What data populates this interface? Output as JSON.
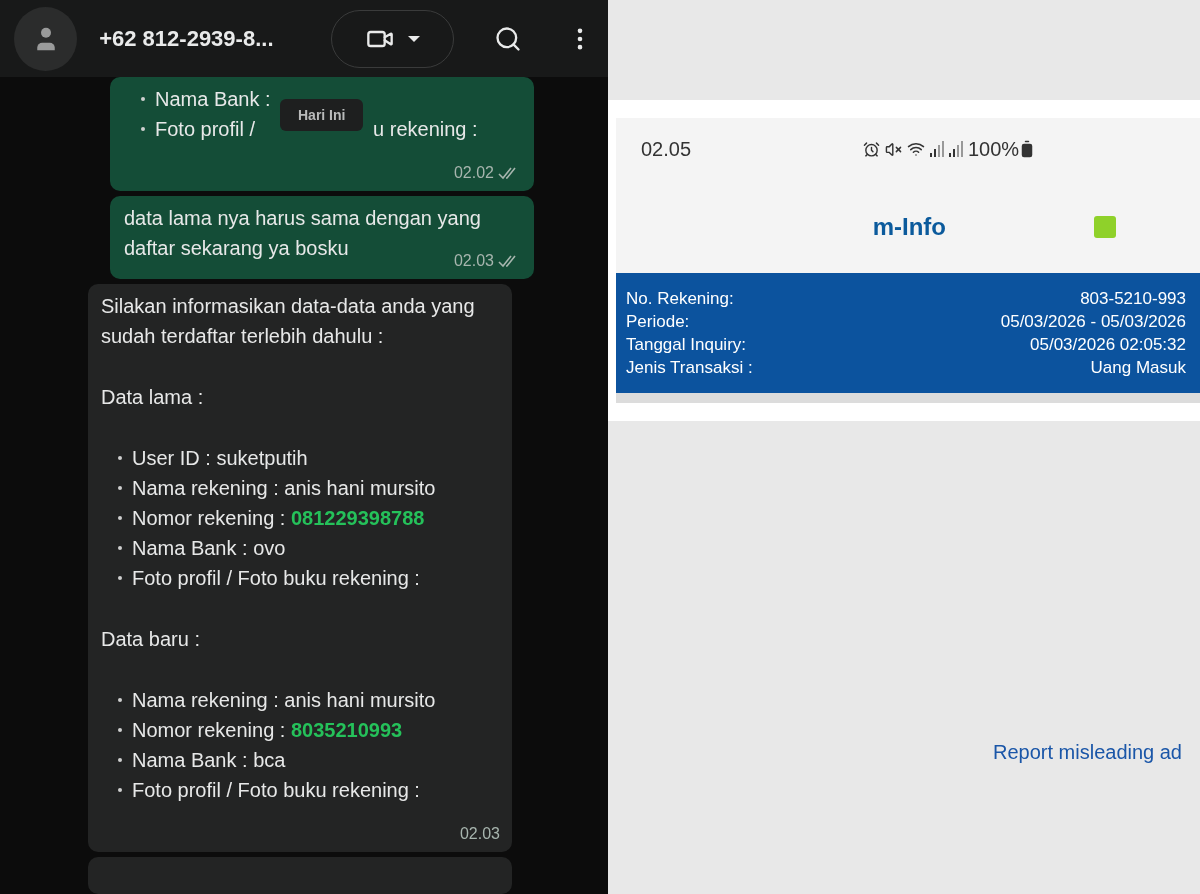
{
  "chat": {
    "header": {
      "title": "+62 812-2939-8..."
    },
    "date_chip": "Hari Ini",
    "messages": [
      {
        "kind": "sent",
        "read": true,
        "time": "02.02",
        "lines": [
          {
            "kind": "bullet",
            "text": "Nama Bank :"
          },
          {
            "kind": "bullet",
            "text": "Foto profil /",
            "after": "u rekening :"
          },
          {
            "kind": "gap"
          }
        ]
      },
      {
        "kind": "sent",
        "read": true,
        "time": "02.03",
        "lines": [
          {
            "kind": "text",
            "text": "data lama nya harus sama dengan yang"
          },
          {
            "kind": "text",
            "text": "daftar sekarang ya bosku"
          }
        ]
      },
      {
        "kind": "received",
        "time": "02.03",
        "lines": [
          {
            "kind": "text",
            "text": "Silakan informasikan data-data anda yang"
          },
          {
            "kind": "text",
            "text": "sudah terdaftar terlebih dahulu :"
          },
          {
            "kind": "gap"
          },
          {
            "kind": "text",
            "text": "Data lama :"
          },
          {
            "kind": "gap"
          },
          {
            "kind": "bullet",
            "text": "User ID : suketputih"
          },
          {
            "kind": "bullet",
            "text": "Nama rekening : anis hani mursito"
          },
          {
            "kind": "bullet",
            "text": "Nomor rekening : ",
            "value": "081229398788"
          },
          {
            "kind": "bullet",
            "text": "Nama Bank : ovo"
          },
          {
            "kind": "bullet",
            "text": "Foto profil / Foto buku rekening :"
          },
          {
            "kind": "gap"
          },
          {
            "kind": "text",
            "text": "Data baru :"
          },
          {
            "kind": "gap"
          },
          {
            "kind": "bullet",
            "text": "Nama rekening : anis hani mursito"
          },
          {
            "kind": "bullet",
            "text": "Nomor rekening : ",
            "value": "8035210993"
          },
          {
            "kind": "bullet",
            "text": "Nama Bank : bca"
          },
          {
            "kind": "bullet",
            "text": "Foto profil / Foto buku rekening :"
          },
          {
            "kind": "gap"
          }
        ]
      }
    ]
  },
  "phone": {
    "status_time": "02.05",
    "battery": "100%",
    "app_title": "m-Info",
    "info": [
      {
        "label": "No. Rekening:",
        "value": "803-5210-993"
      },
      {
        "label": "Periode:",
        "value": "05/03/2026 - 05/03/2026"
      },
      {
        "label": "Tanggal Inquiry:",
        "value": "05/03/2026 02:05:32"
      },
      {
        "label": "Jenis Transaksi :",
        "value": "Uang Masuk"
      }
    ]
  },
  "report_link": "Report misleading ad"
}
